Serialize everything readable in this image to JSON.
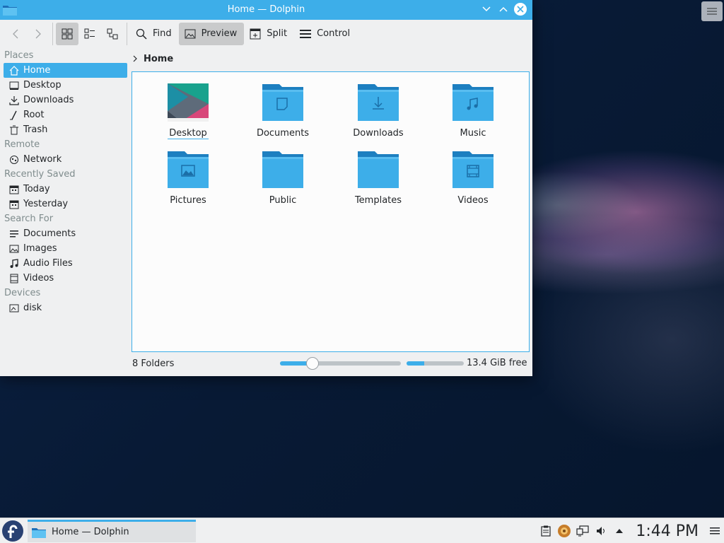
{
  "window": {
    "title": "Home — Dolphin"
  },
  "toolbar": {
    "find_label": "Find",
    "preview_label": "Preview",
    "split_label": "Split",
    "control_label": "Control"
  },
  "sidebar": {
    "sections": [
      {
        "title": "Places",
        "items": [
          "Home",
          "Desktop",
          "Downloads",
          "Root",
          "Trash"
        ]
      },
      {
        "title": "Remote",
        "items": [
          "Network"
        ]
      },
      {
        "title": "Recently Saved",
        "items": [
          "Today",
          "Yesterday"
        ]
      },
      {
        "title": "Search For",
        "items": [
          "Documents",
          "Images",
          "Audio Files",
          "Videos"
        ]
      },
      {
        "title": "Devices",
        "items": [
          "disk"
        ]
      }
    ],
    "selected": "Home"
  },
  "breadcrumb": {
    "current": "Home"
  },
  "files": [
    {
      "name": "Desktop",
      "icon": "desktop-folder-icon"
    },
    {
      "name": "Documents",
      "icon": "documents-folder-icon"
    },
    {
      "name": "Downloads",
      "icon": "downloads-folder-icon"
    },
    {
      "name": "Music",
      "icon": "music-folder-icon"
    },
    {
      "name": "Pictures",
      "icon": "pictures-folder-icon"
    },
    {
      "name": "Public",
      "icon": "folder-icon"
    },
    {
      "name": "Templates",
      "icon": "folder-icon"
    },
    {
      "name": "Videos",
      "icon": "videos-folder-icon"
    }
  ],
  "status": {
    "summary": "8 Folders",
    "free_space": "13.4 GiB free",
    "zoom_fraction": 0.27,
    "disk_used_fraction": 0.31
  },
  "taskbar": {
    "task_label": "Home — Dolphin",
    "clock": "1:44 PM"
  },
  "colors": {
    "accent": "#3daee9",
    "folder": "#3daee9",
    "folder_tab": "#1d99d3"
  }
}
